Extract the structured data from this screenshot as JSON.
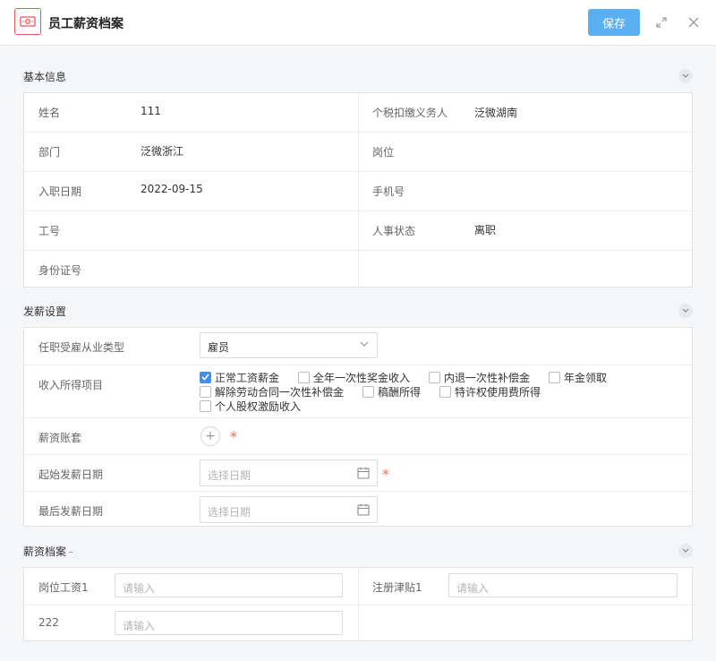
{
  "header": {
    "title": "员工薪资档案",
    "save_label": "保存",
    "icons": [
      "money-icon",
      "expand-icon",
      "close-icon"
    ]
  },
  "basic": {
    "section_title": "基本信息",
    "name_label": "姓名",
    "name_value": "111",
    "withholding_label": "个税扣缴义务人",
    "withholding_value": "泛微湖南",
    "dept_label": "部门",
    "dept_value": "泛微浙江",
    "position_label": "岗位",
    "position_value": "",
    "hire_label": "入职日期",
    "hire_value": "2022-09-15",
    "phone_label": "手机号",
    "phone_value": "",
    "empno_label": "工号",
    "empno_value": "",
    "status_label": "人事状态",
    "status_value": "离职",
    "idcard_label": "身份证号",
    "idcard_value": ""
  },
  "payroll": {
    "section_title": "发薪设置",
    "emp_type_label": "任职受雇从业类型",
    "emp_type_value": "雇员",
    "income_label": "收入所得项目",
    "income_items": [
      {
        "label": "正常工资薪金",
        "checked": true
      },
      {
        "label": "全年一次性奖金收入",
        "checked": false
      },
      {
        "label": "内退一次性补偿金",
        "checked": false
      },
      {
        "label": "年金领取",
        "checked": false
      },
      {
        "label": "解除劳动合同一次性补偿金",
        "checked": false
      },
      {
        "label": "稿酬所得",
        "checked": false
      },
      {
        "label": "特许权使用费所得",
        "checked": false
      },
      {
        "label": "个人股权激励收入",
        "checked": false
      }
    ],
    "account_label": "薪资账套",
    "add_symbol": "+",
    "required_mark": "*",
    "start_date_label": "起始发薪日期",
    "end_date_label": "最后发薪日期",
    "date_placeholder": "选择日期"
  },
  "archive": {
    "section_title": "薪资档案",
    "title_suffix": "–",
    "base_salary_label": "岗位工资1",
    "allowance_label": "注册津贴1",
    "field_222_label": "222",
    "input_placeholder": "请输入"
  },
  "colors": {
    "accent": "#5ab0f3",
    "required": "#f26b4e",
    "checkbox": "#3f8ff2"
  }
}
